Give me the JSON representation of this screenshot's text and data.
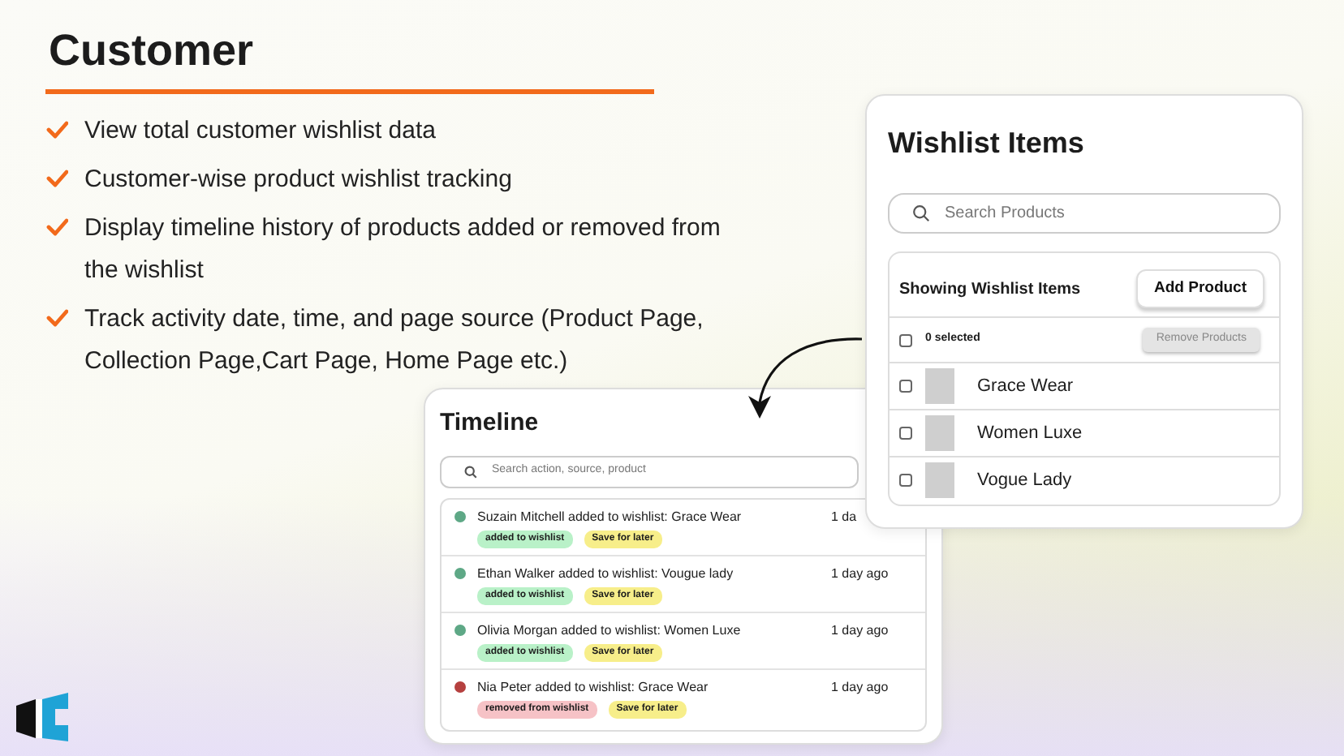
{
  "heading": "Customer",
  "features": [
    "View total customer wishlist data",
    "Customer-wise product wishlist tracking",
    "Display timeline history of products added or removed from the wishlist",
    "Track activity date, time, and page source (Product Page, Collection Page,Cart Page, Home Page etc.)"
  ],
  "wishlist_panel": {
    "title": "Wishlist Items",
    "search": {
      "placeholder": "Search Products"
    },
    "list_title": "Showing Wishlist Items",
    "add_button": "Add Product",
    "select_all": {
      "checked": false
    },
    "selected_count": "0 selected",
    "remove_button": {
      "label": "Remove Products",
      "disabled": true
    },
    "items": [
      {
        "name": "Grace Wear",
        "checked": false
      },
      {
        "name": "Women Luxe",
        "checked": false
      },
      {
        "name": "Vogue Lady",
        "checked": false
      }
    ]
  },
  "timeline": {
    "title": "Timeline",
    "search": {
      "placeholder": "Search action, source, product"
    },
    "events": [
      {
        "text": "Suzain Mitchell added to wishlist: Grace Wear",
        "time": "1 da",
        "color": "#5ea886",
        "tags": [
          {
            "kind": "added",
            "label": "added to wishlist"
          },
          {
            "kind": "save",
            "label": "Save for later"
          }
        ]
      },
      {
        "text": "Ethan Walker added to wishlist: Vougue lady",
        "time": "1 day ago",
        "color": "#5ea886",
        "tags": [
          {
            "kind": "added",
            "label": "added to wishlist"
          },
          {
            "kind": "save",
            "label": "Save for later"
          }
        ]
      },
      {
        "text": "Olivia Morgan added to wishlist: Women Luxe",
        "time": "1 day ago",
        "color": "#5ea886",
        "tags": [
          {
            "kind": "added",
            "label": "added to wishlist"
          },
          {
            "kind": "save",
            "label": "Save for later"
          }
        ]
      },
      {
        "text": "Nia Peter added to wishlist: Grace Wear",
        "time": "1 day ago",
        "color": "#b5403f",
        "tags": [
          {
            "kind": "removed",
            "label": "removed from wishlist"
          },
          {
            "kind": "save",
            "label": "Save for later"
          }
        ]
      }
    ]
  }
}
